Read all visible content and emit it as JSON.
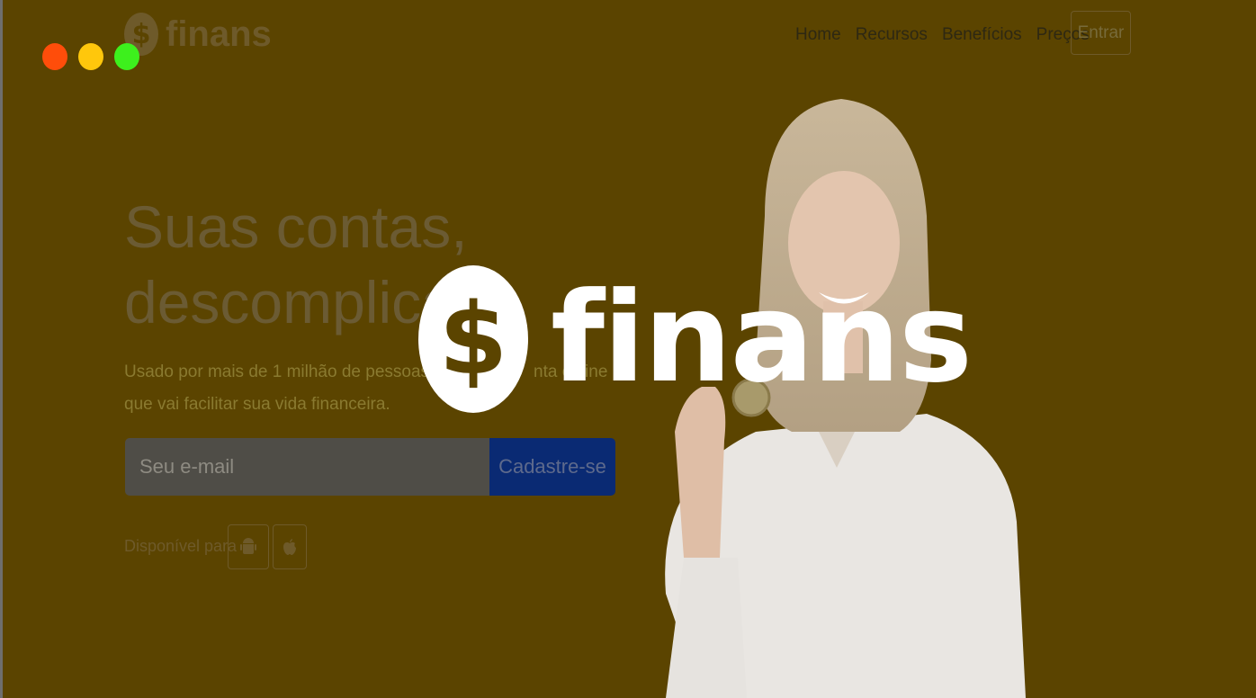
{
  "window": {
    "controls": [
      "close",
      "minimize",
      "maximize"
    ]
  },
  "brand": {
    "name": "finans",
    "coin_symbol": "$"
  },
  "nav": {
    "items": [
      "Home",
      "Recursos",
      "Benefícios",
      "Preços"
    ],
    "login_label": "Entrar"
  },
  "hero": {
    "headline_line1": "Suas contas,",
    "headline_line2": "descomplicad",
    "subtitle_line1": "Usado por mais de 1 milhão de pessoas, o Fina",
    "subtitle_line1_tail": "nta online",
    "subtitle_line2": "que vai facilitar sua vida financeira.",
    "email_placeholder": "Seu e-mail",
    "signup_label": "Cadastre-se",
    "available_label": "Disponível para"
  },
  "splash": {
    "brand": "finans",
    "coin_symbol": "$"
  },
  "icons": [
    "android-icon",
    "apple-icon"
  ],
  "colors": {
    "background": "#5b4400",
    "button": "#0a2a73",
    "splash_text": "#ffffff"
  }
}
